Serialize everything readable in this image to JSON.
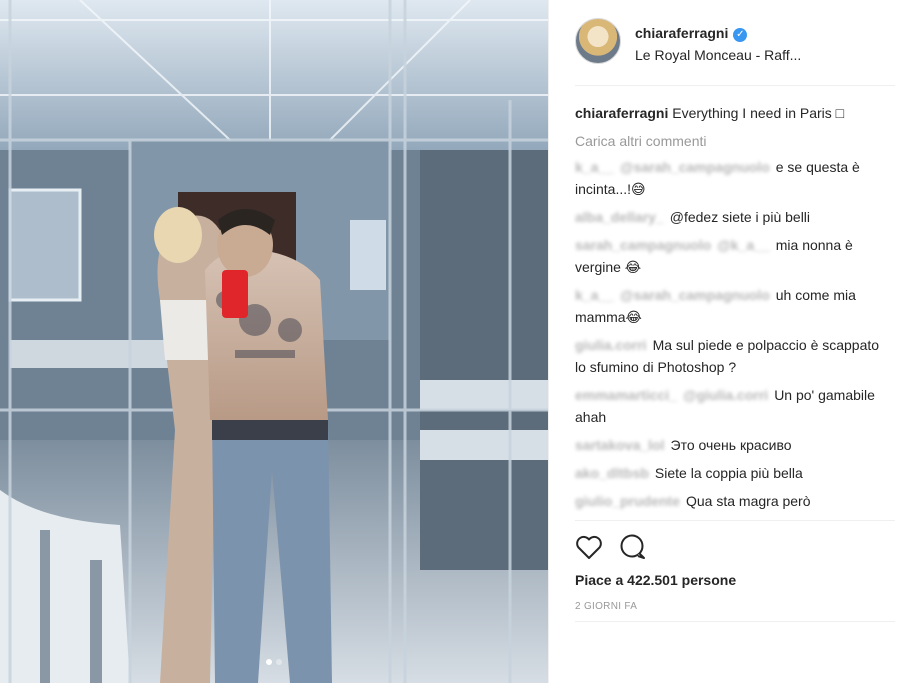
{
  "post": {
    "username": "chiaraferragni",
    "location": "Le Royal Monceau - Raff...",
    "caption": "Everything I need in Paris □",
    "load_more": "Carica altri commenti",
    "likes": "Piace a 422.501 persone",
    "time_ago": "2 GIORNI FA"
  },
  "comments": [
    {
      "user": "k_a__",
      "extra": "@sarah_campagnuolo",
      "text": "e se questa è incinta...!😅"
    },
    {
      "user": "alba_dellary_",
      "extra": "",
      "text": "@fedez siete i più belli"
    },
    {
      "user": "sarah_campagnuolo",
      "extra": "@k_a__",
      "text": "mia nonna è vergine 😂"
    },
    {
      "user": "k_a__",
      "extra": "@sarah_campagnuolo",
      "text": "uh come mia mamma😂"
    },
    {
      "user": "giulia.corri",
      "extra": "",
      "text": "Ma sul piede e polpaccio è scappato lo sfumino di Photoshop ?"
    },
    {
      "user": "emmamarticci_",
      "extra": "@giulia.corri",
      "text": "Un po' gamabile ahah"
    },
    {
      "user": "sartakova_lol",
      "extra": "",
      "text": "Это очень красиво"
    },
    {
      "user": "ako_dltbsb",
      "extra": "",
      "text": "Siete la coppia più bella"
    },
    {
      "user": "giulio_prudente",
      "extra": "",
      "text": "Qua sta magra però"
    }
  ],
  "icons": {
    "like": "heart-icon",
    "comment": "comment-bubble-icon",
    "verified": "verified-badge-icon"
  },
  "colors": {
    "accent": "#3897f0",
    "muted": "#999999",
    "text": "#262626"
  },
  "carousel": {
    "total": 2,
    "active": 1
  }
}
